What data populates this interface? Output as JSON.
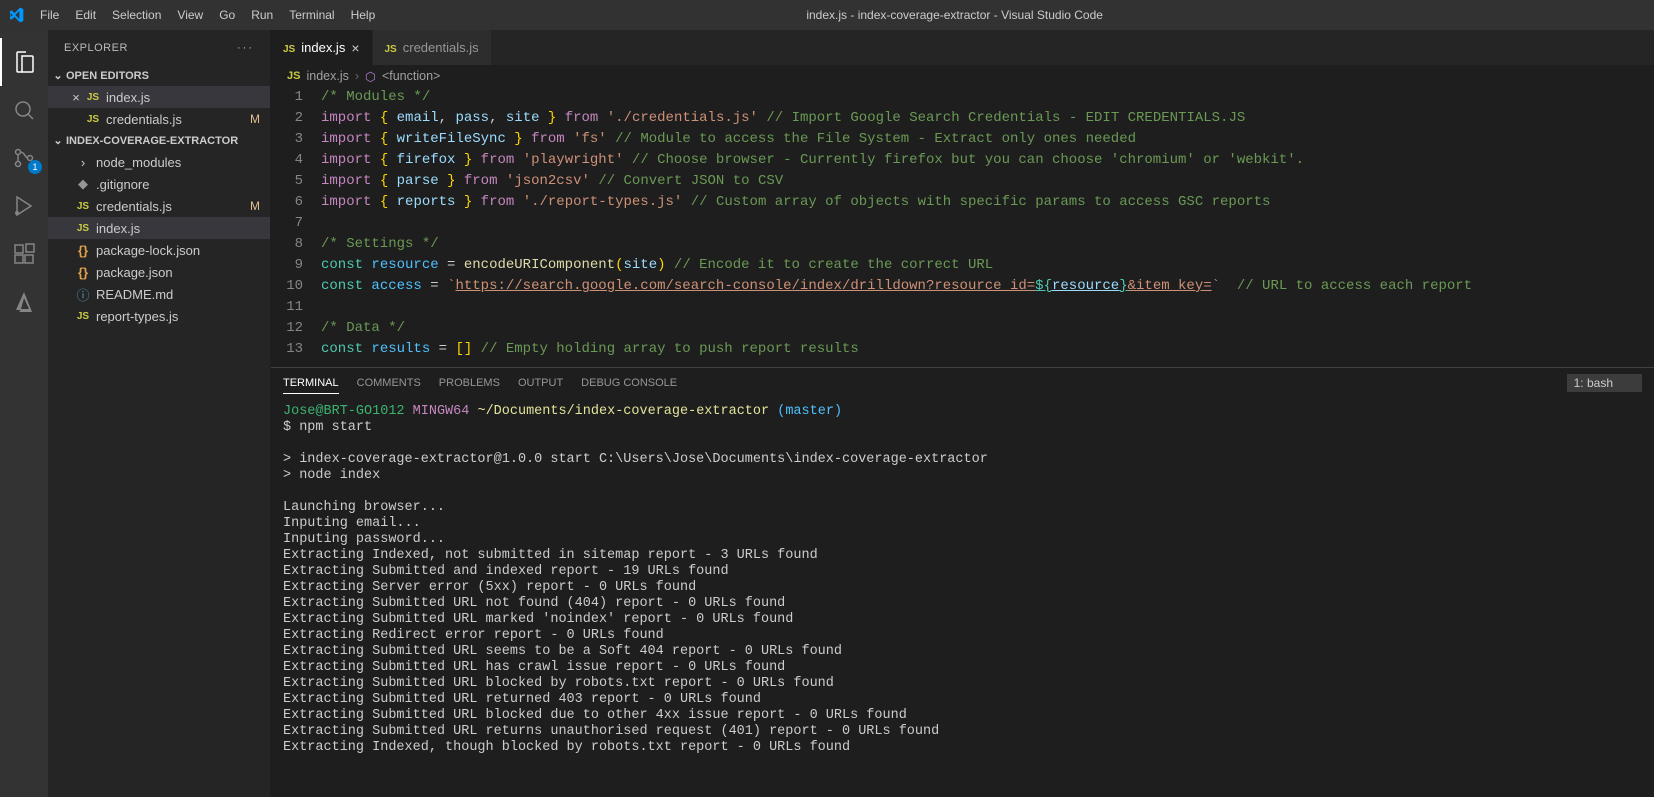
{
  "window": {
    "title": "index.js - index-coverage-extractor - Visual Studio Code"
  },
  "menubar": [
    "File",
    "Edit",
    "Selection",
    "View",
    "Go",
    "Run",
    "Terminal",
    "Help"
  ],
  "activitybar": {
    "scm_badge": "1"
  },
  "sidebar": {
    "title": "EXPLORER",
    "openEditors": {
      "label": "OPEN EDITORS",
      "items": [
        {
          "name": "index.js",
          "icon": "js",
          "active": true,
          "dirty": false
        },
        {
          "name": "credentials.js",
          "icon": "js",
          "badge": "M"
        }
      ]
    },
    "project": {
      "label": "INDEX-COVERAGE-EXTRACTOR",
      "items": [
        {
          "name": "node_modules",
          "type": "folder"
        },
        {
          "name": ".gitignore",
          "type": "file",
          "icon": "git"
        },
        {
          "name": "credentials.js",
          "type": "file",
          "icon": "js",
          "badge": "M"
        },
        {
          "name": "index.js",
          "type": "file",
          "icon": "js",
          "active": true
        },
        {
          "name": "package-lock.json",
          "type": "file",
          "icon": "json"
        },
        {
          "name": "package.json",
          "type": "file",
          "icon": "json"
        },
        {
          "name": "README.md",
          "type": "file",
          "icon": "info"
        },
        {
          "name": "report-types.js",
          "type": "file",
          "icon": "js"
        }
      ]
    }
  },
  "tabs": [
    {
      "name": "index.js",
      "icon": "js",
      "active": true
    },
    {
      "name": "credentials.js",
      "icon": "js"
    }
  ],
  "breadcrumb": {
    "file": "index.js",
    "symbol": "<function>"
  },
  "code_lines": [
    {
      "n": 1,
      "tokens": [
        {
          "t": "/* Modules */",
          "c": "tok-com"
        }
      ]
    },
    {
      "n": 2,
      "tokens": [
        {
          "t": "import",
          "c": "tok-kw"
        },
        {
          "t": " "
        },
        {
          "t": "{",
          "c": "tok-br"
        },
        {
          "t": " "
        },
        {
          "t": "email",
          "c": "tok-var"
        },
        {
          "t": ", "
        },
        {
          "t": "pass",
          "c": "tok-var"
        },
        {
          "t": ", "
        },
        {
          "t": "site",
          "c": "tok-var"
        },
        {
          "t": " "
        },
        {
          "t": "}",
          "c": "tok-br"
        },
        {
          "t": " "
        },
        {
          "t": "from",
          "c": "tok-kw"
        },
        {
          "t": " "
        },
        {
          "t": "'./credentials.js'",
          "c": "tok-str"
        },
        {
          "t": " "
        },
        {
          "t": "// Import Google Search Credentials - EDIT CREDENTIALS.JS",
          "c": "tok-com"
        }
      ]
    },
    {
      "n": 3,
      "tokens": [
        {
          "t": "import",
          "c": "tok-kw"
        },
        {
          "t": " "
        },
        {
          "t": "{",
          "c": "tok-br"
        },
        {
          "t": " "
        },
        {
          "t": "writeFileSync",
          "c": "tok-var"
        },
        {
          "t": " "
        },
        {
          "t": "}",
          "c": "tok-br"
        },
        {
          "t": " "
        },
        {
          "t": "from",
          "c": "tok-kw"
        },
        {
          "t": " "
        },
        {
          "t": "'fs'",
          "c": "tok-str"
        },
        {
          "t": " "
        },
        {
          "t": "// Module to access the File System - Extract only ones needed",
          "c": "tok-com"
        }
      ]
    },
    {
      "n": 4,
      "tokens": [
        {
          "t": "import",
          "c": "tok-kw"
        },
        {
          "t": " "
        },
        {
          "t": "{",
          "c": "tok-br"
        },
        {
          "t": " "
        },
        {
          "t": "firefox",
          "c": "tok-var"
        },
        {
          "t": " "
        },
        {
          "t": "}",
          "c": "tok-br"
        },
        {
          "t": " "
        },
        {
          "t": "from",
          "c": "tok-kw"
        },
        {
          "t": " "
        },
        {
          "t": "'playwright'",
          "c": "tok-str"
        },
        {
          "t": " "
        },
        {
          "t": "// Choose browser - Currently firefox but you can choose 'chromium' or 'webkit'.",
          "c": "tok-com"
        }
      ]
    },
    {
      "n": 5,
      "tokens": [
        {
          "t": "import",
          "c": "tok-kw"
        },
        {
          "t": " "
        },
        {
          "t": "{",
          "c": "tok-br"
        },
        {
          "t": " "
        },
        {
          "t": "parse",
          "c": "tok-var"
        },
        {
          "t": " "
        },
        {
          "t": "}",
          "c": "tok-br"
        },
        {
          "t": " "
        },
        {
          "t": "from",
          "c": "tok-kw"
        },
        {
          "t": " "
        },
        {
          "t": "'json2csv'",
          "c": "tok-str"
        },
        {
          "t": " "
        },
        {
          "t": "// Convert JSON to CSV",
          "c": "tok-com"
        }
      ]
    },
    {
      "n": 6,
      "tokens": [
        {
          "t": "import",
          "c": "tok-kw"
        },
        {
          "t": " "
        },
        {
          "t": "{",
          "c": "tok-br"
        },
        {
          "t": " "
        },
        {
          "t": "reports",
          "c": "tok-var"
        },
        {
          "t": " "
        },
        {
          "t": "}",
          "c": "tok-br"
        },
        {
          "t": " "
        },
        {
          "t": "from",
          "c": "tok-kw"
        },
        {
          "t": " "
        },
        {
          "t": "'./report-types.js'",
          "c": "tok-str"
        },
        {
          "t": " "
        },
        {
          "t": "// Custom array of objects with specific params to access GSC reports",
          "c": "tok-com"
        }
      ]
    },
    {
      "n": 7,
      "tokens": []
    },
    {
      "n": 8,
      "tokens": [
        {
          "t": "/* Settings */",
          "c": "tok-com"
        }
      ]
    },
    {
      "n": 9,
      "tokens": [
        {
          "t": "const",
          "c": "tok-type"
        },
        {
          "t": " "
        },
        {
          "t": "resource",
          "c": "tok-const"
        },
        {
          "t": " = "
        },
        {
          "t": "encodeURIComponent",
          "c": "tok-fn"
        },
        {
          "t": "(",
          "c": "tok-br"
        },
        {
          "t": "site",
          "c": "tok-var"
        },
        {
          "t": ")",
          "c": "tok-br"
        },
        {
          "t": " "
        },
        {
          "t": "// Encode it to create the correct URL",
          "c": "tok-com"
        }
      ]
    },
    {
      "n": 10,
      "tokens": [
        {
          "t": "const",
          "c": "tok-type"
        },
        {
          "t": " "
        },
        {
          "t": "access",
          "c": "tok-const"
        },
        {
          "t": " = "
        },
        {
          "t": "`",
          "c": "tok-str"
        },
        {
          "t": "https://search.google.com/search-console/index/drilldown?resource_id=",
          "c": "tok-str url-underline"
        },
        {
          "t": "${",
          "c": "tok-type url-underline"
        },
        {
          "t": "resource",
          "c": "tok-var url-underline"
        },
        {
          "t": "}",
          "c": "tok-type url-underline"
        },
        {
          "t": "&item_key=",
          "c": "tok-str url-underline"
        },
        {
          "t": "`",
          "c": "tok-str"
        },
        {
          "t": "  "
        },
        {
          "t": "// URL to access each report",
          "c": "tok-com"
        }
      ]
    },
    {
      "n": 11,
      "tokens": []
    },
    {
      "n": 12,
      "tokens": [
        {
          "t": "/* Data */",
          "c": "tok-com"
        }
      ]
    },
    {
      "n": 13,
      "tokens": [
        {
          "t": "const",
          "c": "tok-type"
        },
        {
          "t": " "
        },
        {
          "t": "results",
          "c": "tok-const"
        },
        {
          "t": " = "
        },
        {
          "t": "[",
          "c": "tok-br"
        },
        {
          "t": "]",
          "c": "tok-br"
        },
        {
          "t": " "
        },
        {
          "t": "// Empty holding array to push report results",
          "c": "tok-com"
        }
      ]
    }
  ],
  "panel": {
    "tabs": [
      "TERMINAL",
      "COMMENTS",
      "PROBLEMS",
      "OUTPUT",
      "DEBUG CONSOLE"
    ],
    "active_tab": "TERMINAL",
    "terminal_select": "1: bash",
    "prompt": {
      "user": "Jose@BRT-GO1012",
      "sys": "MINGW64",
      "path": "~/Documents/index-coverage-extractor",
      "branch": "(master)"
    },
    "command": "$ npm start",
    "output": [
      "",
      "> index-coverage-extractor@1.0.0 start C:\\Users\\Jose\\Documents\\index-coverage-extractor",
      "> node index",
      "",
      "Launching browser...",
      "Inputing email...",
      "Inputing password...",
      "Extracting Indexed, not submitted in sitemap report - 3 URLs found",
      "Extracting Submitted and indexed report - 19 URLs found",
      "Extracting Server error (5xx) report - 0 URLs found",
      "Extracting Submitted URL not found (404) report - 0 URLs found",
      "Extracting Submitted URL marked 'noindex' report - 0 URLs found",
      "Extracting Redirect error report - 0 URLs found",
      "Extracting Submitted URL seems to be a Soft 404 report - 0 URLs found",
      "Extracting Submitted URL has crawl issue report - 0 URLs found",
      "Extracting Submitted URL blocked by robots.txt report - 0 URLs found",
      "Extracting Submitted URL returned 403 report - 0 URLs found",
      "Extracting Submitted URL blocked due to other 4xx issue report - 0 URLs found",
      "Extracting Submitted URL returns unauthorised request (401) report - 0 URLs found",
      "Extracting Indexed, though blocked by robots.txt report - 0 URLs found"
    ]
  }
}
